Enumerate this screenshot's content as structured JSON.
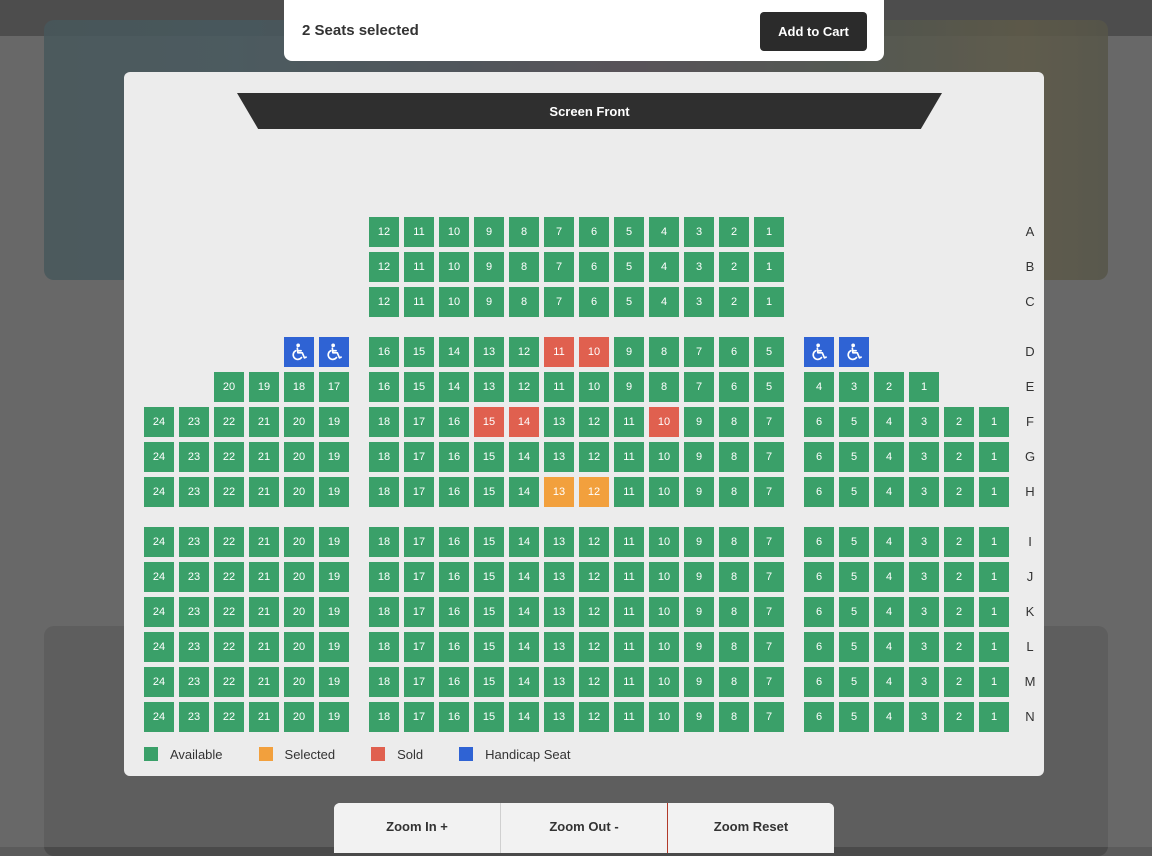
{
  "top_bar": {
    "selection_text": "2 Seats selected",
    "cart_label": "Add to Cart"
  },
  "screen_label": "Screen Front",
  "colors": {
    "available": "#3aa069",
    "selected": "#f2a03d",
    "sold": "#e0604f",
    "handicap": "#2f63d4"
  },
  "legend": [
    {
      "label": "Available",
      "status": "available"
    },
    {
      "label": "Selected",
      "status": "selected"
    },
    {
      "label": "Sold",
      "status": "sold"
    },
    {
      "label": "Handicap Seat",
      "status": "handicap"
    }
  ],
  "handicap_icon": "wheelchair-icon",
  "rows": [
    {
      "label": "A",
      "left": [],
      "center": [
        "12",
        "11",
        "10",
        "9",
        "8",
        "7",
        "6",
        "5",
        "4",
        "3",
        "2",
        "1"
      ],
      "right": []
    },
    {
      "label": "B",
      "left": [],
      "center": [
        "12",
        "11",
        "10",
        "9",
        "8",
        "7",
        "6",
        "5",
        "4",
        "3",
        "2",
        "1"
      ],
      "right": []
    },
    {
      "label": "C",
      "left": [],
      "center": [
        "12",
        "11",
        "10",
        "9",
        "8",
        "7",
        "6",
        "5",
        "4",
        "3",
        "2",
        "1"
      ],
      "right": []
    },
    {
      "label": "D",
      "left": [
        "",
        "",
        "",
        "",
        "H",
        "H"
      ],
      "center": [
        "16",
        "15",
        "14",
        "13",
        "12",
        "11",
        "10",
        "9",
        "8",
        "7",
        "6",
        "5"
      ],
      "right": [
        "H",
        "H",
        "",
        "",
        "",
        ""
      ],
      "sold": [
        "11",
        "10"
      ]
    },
    {
      "label": "E",
      "left": [
        "",
        "",
        "20",
        "19",
        "18",
        "17"
      ],
      "center": [
        "16",
        "15",
        "14",
        "13",
        "12",
        "11",
        "10",
        "9",
        "8",
        "7",
        "6",
        "5"
      ],
      "right": [
        "4",
        "3",
        "2",
        "1",
        "",
        ""
      ]
    },
    {
      "label": "F",
      "left": [
        "24",
        "23",
        "22",
        "21",
        "20",
        "19"
      ],
      "center": [
        "18",
        "17",
        "16",
        "15",
        "14",
        "13",
        "12",
        "11",
        "10",
        "9",
        "8",
        "7"
      ],
      "right": [
        "6",
        "5",
        "4",
        "3",
        "2",
        "1"
      ],
      "sold": [
        "15",
        "14",
        "10"
      ]
    },
    {
      "label": "G",
      "left": [
        "24",
        "23",
        "22",
        "21",
        "20",
        "19"
      ],
      "center": [
        "18",
        "17",
        "16",
        "15",
        "14",
        "13",
        "12",
        "11",
        "10",
        "9",
        "8",
        "7"
      ],
      "right": [
        "6",
        "5",
        "4",
        "3",
        "2",
        "1"
      ]
    },
    {
      "label": "H",
      "left": [
        "24",
        "23",
        "22",
        "21",
        "20",
        "19"
      ],
      "center": [
        "18",
        "17",
        "16",
        "15",
        "14",
        "13",
        "12",
        "11",
        "10",
        "9",
        "8",
        "7"
      ],
      "right": [
        "6",
        "5",
        "4",
        "3",
        "2",
        "1"
      ],
      "selected": [
        "13",
        "12"
      ]
    },
    {
      "label": "I",
      "left": [
        "24",
        "23",
        "22",
        "21",
        "20",
        "19"
      ],
      "center": [
        "18",
        "17",
        "16",
        "15",
        "14",
        "13",
        "12",
        "11",
        "10",
        "9",
        "8",
        "7"
      ],
      "right": [
        "6",
        "5",
        "4",
        "3",
        "2",
        "1"
      ]
    },
    {
      "label": "J",
      "left": [
        "24",
        "23",
        "22",
        "21",
        "20",
        "19"
      ],
      "center": [
        "18",
        "17",
        "16",
        "15",
        "14",
        "13",
        "12",
        "11",
        "10",
        "9",
        "8",
        "7"
      ],
      "right": [
        "6",
        "5",
        "4",
        "3",
        "2",
        "1"
      ]
    },
    {
      "label": "K",
      "left": [
        "24",
        "23",
        "22",
        "21",
        "20",
        "19"
      ],
      "center": [
        "18",
        "17",
        "16",
        "15",
        "14",
        "13",
        "12",
        "11",
        "10",
        "9",
        "8",
        "7"
      ],
      "right": [
        "6",
        "5",
        "4",
        "3",
        "2",
        "1"
      ]
    },
    {
      "label": "L",
      "left": [
        "24",
        "23",
        "22",
        "21",
        "20",
        "19"
      ],
      "center": [
        "18",
        "17",
        "16",
        "15",
        "14",
        "13",
        "12",
        "11",
        "10",
        "9",
        "8",
        "7"
      ],
      "right": [
        "6",
        "5",
        "4",
        "3",
        "2",
        "1"
      ]
    },
    {
      "label": "M",
      "left": [
        "24",
        "23",
        "22",
        "21",
        "20",
        "19"
      ],
      "center": [
        "18",
        "17",
        "16",
        "15",
        "14",
        "13",
        "12",
        "11",
        "10",
        "9",
        "8",
        "7"
      ],
      "right": [
        "6",
        "5",
        "4",
        "3",
        "2",
        "1"
      ]
    },
    {
      "label": "N",
      "left": [
        "24",
        "23",
        "22",
        "21",
        "20",
        "19"
      ],
      "center": [
        "18",
        "17",
        "16",
        "15",
        "14",
        "13",
        "12",
        "11",
        "10",
        "9",
        "8",
        "7"
      ],
      "right": [
        "6",
        "5",
        "4",
        "3",
        "2",
        "1"
      ]
    }
  ],
  "zoom": {
    "zoom_in": "Zoom In +",
    "zoom_out": "Zoom Out -",
    "zoom_reset": "Zoom Reset"
  }
}
